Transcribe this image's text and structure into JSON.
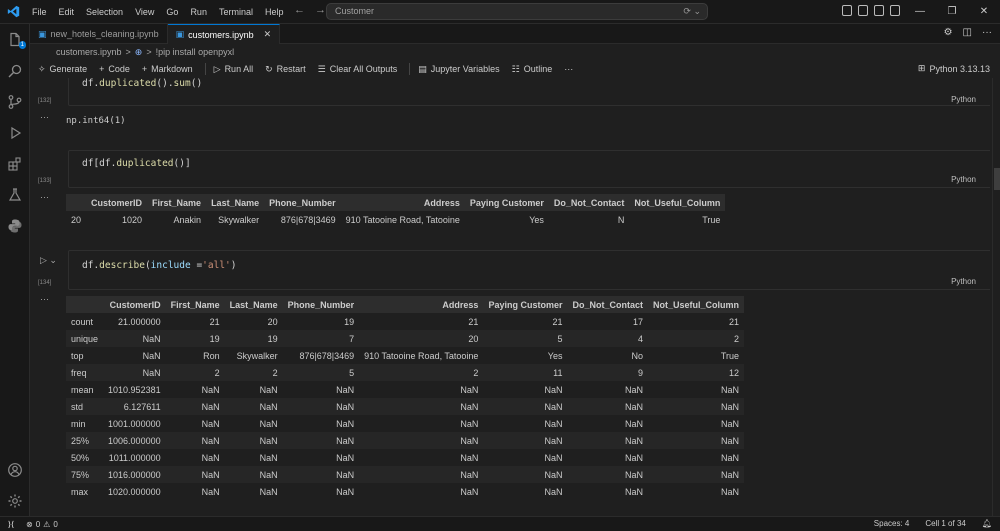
{
  "titlebar": {
    "menu": [
      "File",
      "Edit",
      "Selection",
      "View",
      "Go",
      "Run",
      "Terminal",
      "Help"
    ],
    "search": "Customer"
  },
  "tabs": [
    {
      "label": "new_hotels_cleaning.ipynb",
      "active": false
    },
    {
      "label": "customers.ipynb",
      "active": true
    }
  ],
  "breadcrumb": {
    "file": "customers.ipynb",
    "separator": ">",
    "cell": "!pip install openpyxl"
  },
  "toolbar": {
    "generate": "Generate",
    "code": "Code",
    "markdown": "Markdown",
    "run_all": "Run All",
    "restart": "Restart",
    "clear_outputs": "Clear All Outputs",
    "variables": "Jupyter Variables",
    "outline": "Outline",
    "more": "···",
    "kernel": "Python 3.13.13"
  },
  "cells": [
    {
      "exec": "[132]",
      "code": "df.duplicated().sum()",
      "lang": "Python",
      "output": "np.int64(1)"
    },
    {
      "exec": "[133]",
      "code": "df[df.duplicated()]",
      "lang": "Python"
    },
    {
      "exec": "[134]",
      "code": "df.describe(include ='all')",
      "lang": "Python"
    }
  ],
  "table1": {
    "columns": [
      "",
      "CustomerID",
      "First_Name",
      "Last_Name",
      "Phone_Number",
      "Address",
      "Paying Customer",
      "Do_Not_Contact",
      "Not_Useful_Column"
    ],
    "rows": [
      [
        "20",
        "1020",
        "Anakin",
        "Skywalker",
        "876|678|3469",
        "910 Tatooine Road, Tatooine",
        "Yes",
        "N",
        "True"
      ]
    ]
  },
  "table2": {
    "columns": [
      "",
      "CustomerID",
      "First_Name",
      "Last_Name",
      "Phone_Number",
      "Address",
      "Paying Customer",
      "Do_Not_Contact",
      "Not_Useful_Column"
    ],
    "rows": [
      [
        "count",
        "21.000000",
        "21",
        "20",
        "19",
        "21",
        "21",
        "17",
        "21"
      ],
      [
        "unique",
        "NaN",
        "19",
        "19",
        "7",
        "20",
        "5",
        "4",
        "2"
      ],
      [
        "top",
        "NaN",
        "Ron",
        "Skywalker",
        "876|678|3469",
        "910 Tatooine Road, Tatooine",
        "Yes",
        "No",
        "True"
      ],
      [
        "freq",
        "NaN",
        "2",
        "2",
        "5",
        "2",
        "11",
        "9",
        "12"
      ],
      [
        "mean",
        "1010.952381",
        "NaN",
        "NaN",
        "NaN",
        "NaN",
        "NaN",
        "NaN",
        "NaN"
      ],
      [
        "std",
        "6.127611",
        "NaN",
        "NaN",
        "NaN",
        "NaN",
        "NaN",
        "NaN",
        "NaN"
      ],
      [
        "min",
        "1001.000000",
        "NaN",
        "NaN",
        "NaN",
        "NaN",
        "NaN",
        "NaN",
        "NaN"
      ],
      [
        "25%",
        "1006.000000",
        "NaN",
        "NaN",
        "NaN",
        "NaN",
        "NaN",
        "NaN",
        "NaN"
      ],
      [
        "50%",
        "1011.000000",
        "NaN",
        "NaN",
        "NaN",
        "NaN",
        "NaN",
        "NaN",
        "NaN"
      ],
      [
        "75%",
        "1016.000000",
        "NaN",
        "NaN",
        "NaN",
        "NaN",
        "NaN",
        "NaN",
        "NaN"
      ],
      [
        "max",
        "1020.000000",
        "NaN",
        "NaN",
        "NaN",
        "NaN",
        "NaN",
        "NaN",
        "NaN"
      ]
    ]
  },
  "statusbar": {
    "errors": "0",
    "warnings": "0",
    "spaces": "Spaces: 4",
    "cell": "Cell 1 of 34",
    "activity_badge": "1"
  },
  "colors": {
    "accent": "#0078d4",
    "background": "#1f1f1f",
    "chrome": "#181818"
  }
}
